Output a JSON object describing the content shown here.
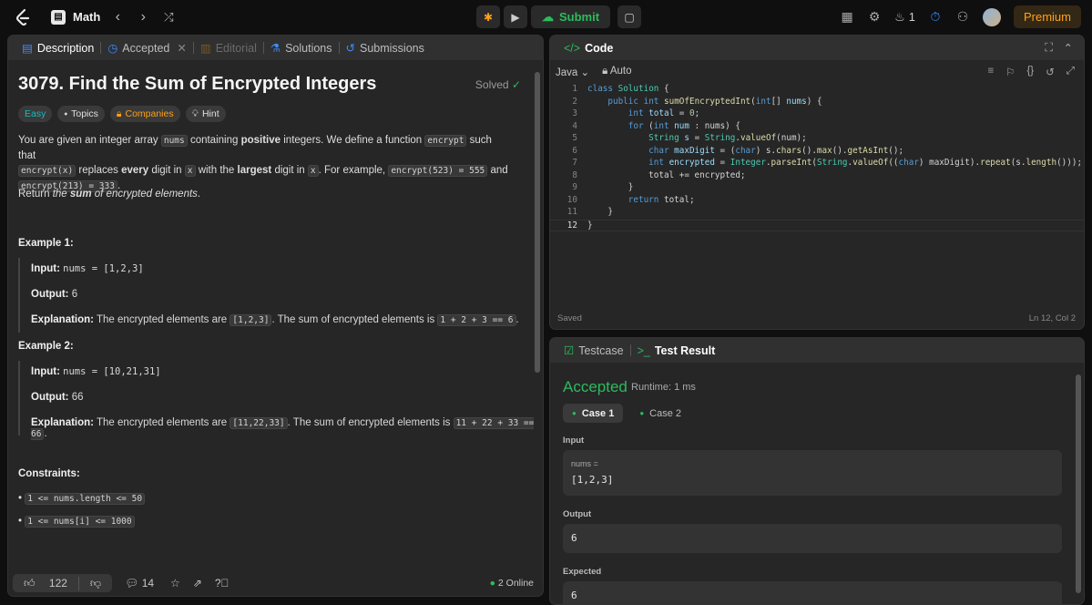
{
  "topbar": {
    "problem_list": "Math",
    "submit_label": "Submit",
    "streak_count": "1",
    "premium_label": "Premium"
  },
  "desc_tabs": [
    "Description",
    "Accepted",
    "Editorial",
    "Solutions",
    "Submissions"
  ],
  "problem": {
    "title": "3079. Find the Sum of Encrypted Integers",
    "status": "Solved",
    "difficulty": "Easy",
    "tag_topics": "Topics",
    "tag_companies": "Companies",
    "tag_hint": "Hint",
    "para1_a": "You are given an integer array ",
    "para1_code1": "nums",
    "para1_b": " containing ",
    "para1_bold1": "positive",
    "para1_c": " integers. We define a function ",
    "para1_code2": "encrypt",
    "para1_d": " such that",
    "para1_code3": "encrypt(x)",
    "para1_e": " replaces ",
    "para1_bold2": "every",
    "para1_f": " digit in ",
    "para1_code4": "x",
    "para1_g": " with the ",
    "para1_bold3": "largest",
    "para1_h": " digit in ",
    "para1_code5": "x",
    "para1_i": ". For example, ",
    "para1_code6": "encrypt(523) = 555",
    "para1_j": " and",
    "para1_code7": "encrypt(213) = 333",
    "para1_k": ".",
    "para2_a": "Return ",
    "para2_i1": "the ",
    "para2_bold": "sum",
    "para2_i2": " of encrypted elements",
    "para2_end": ".",
    "example1_title": "Example 1:",
    "example2_title": "Example 2:",
    "input_label": "Input:",
    "output_label": "Output:",
    "expl_label": "Explanation:",
    "ex1_input": "nums = [1,2,3]",
    "ex1_output": "6",
    "ex1_expl_a": "The encrypted elements are ",
    "ex1_expl_code1": "[1,2,3]",
    "ex1_expl_b": ". The sum of encrypted elements is ",
    "ex1_expl_code2": "1 + 2 + 3 == 6",
    "ex1_expl_c": ".",
    "ex2_input": "nums = [10,21,31]",
    "ex2_output": "66",
    "ex2_expl_a": "The encrypted elements are ",
    "ex2_expl_code1": "[11,22,33]",
    "ex2_expl_b": ". The sum of encrypted elements is ",
    "ex2_expl_code2": "11 + 22 + 33 == 66",
    "ex2_expl_c": ".",
    "constraints_title": "Constraints:",
    "constraint1": "1 <= nums.length <= 50",
    "constraint2": "1 <= nums[i] <= 1000"
  },
  "desc_footer": {
    "likes": "122",
    "comments": "14",
    "online": "2 Online"
  },
  "code": {
    "panel_title": "Code",
    "language": "Java",
    "mode": "Auto",
    "status": "Saved",
    "cursor": "Ln 12, Col 2"
  },
  "test": {
    "tab_testcase": "Testcase",
    "tab_result": "Test Result",
    "result": "Accepted",
    "runtime": "Runtime: 1 ms",
    "case1": "Case 1",
    "case2": "Case 2",
    "input_label": "Input",
    "input_var": "nums =",
    "input_value": "[1,2,3]",
    "output_label": "Output",
    "output_value": "6",
    "expected_label": "Expected",
    "expected_value": "6"
  },
  "colors": {
    "accent_green": "#2cbb5d",
    "premium_orange": "#ffa116",
    "easy_teal": "#1cbaba"
  }
}
